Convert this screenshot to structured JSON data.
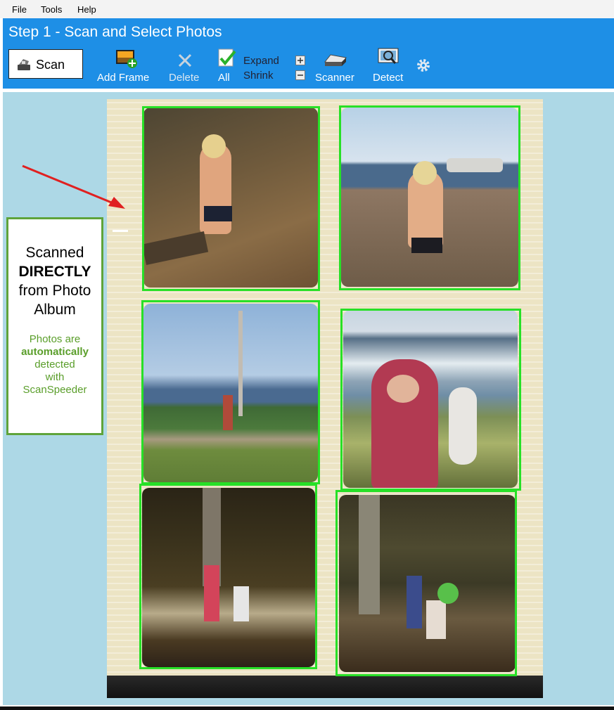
{
  "menu": [
    "File",
    "Tools",
    "Help"
  ],
  "title": "Step 1 - Scan and Select Photos",
  "toolbar": {
    "scan": "Scan",
    "add_frame": "Add Frame",
    "delete": "Delete",
    "all": "All",
    "expand": "Expand",
    "shrink": "Shrink",
    "scanner": "Scanner",
    "detect": "Detect"
  },
  "callout": {
    "line1": "Scanned",
    "line2": "DIRECTLY",
    "line3": "from Photo",
    "line4": "Album",
    "s1": "Photos are",
    "s2": "automatically",
    "s3": "detected",
    "s4": "with",
    "s5": "ScanSpeeder"
  },
  "colors": {
    "toolbar": "#1e8fe6",
    "canvas": "#add8e6",
    "frame": "#27e027",
    "callout_border": "#5fa43a",
    "callout_text": "#5a9e2a",
    "arrow": "#e02020"
  }
}
